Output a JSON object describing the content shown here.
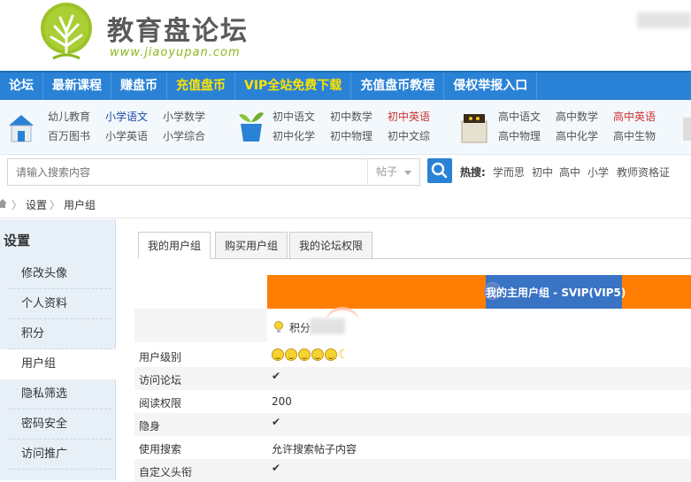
{
  "header": {
    "site_name": "教育盘论坛",
    "site_url": "www.jiaoyupan.com"
  },
  "nav": {
    "items": [
      {
        "label": "论坛",
        "gold": false
      },
      {
        "label": "最新课程",
        "gold": false
      },
      {
        "label": "赚盘币",
        "gold": false
      },
      {
        "label": "充值盘币",
        "gold": true
      },
      {
        "label": "VIP全站免费下载",
        "gold": true
      },
      {
        "label": "充值盘币教程",
        "gold": false
      },
      {
        "label": "侵权举报入口",
        "gold": false
      }
    ]
  },
  "categories": {
    "group1": [
      "幼儿教育",
      "小学语文",
      "小学数学",
      "百万图书",
      "小学英语",
      "小学综合"
    ],
    "group2": [
      "初中语文",
      "初中数学",
      "初中英语",
      "初中化学",
      "初中物理",
      "初中文综"
    ],
    "group3": [
      "高中语文",
      "高中数学",
      "高中英语",
      "高中物理",
      "高中化学",
      "高中生物"
    ]
  },
  "search": {
    "placeholder": "请输入搜索内容",
    "type": "帖子",
    "hot_label": "热搜:",
    "hot_items": [
      "学而思",
      "初中",
      "高中",
      "小学",
      "教师资格证"
    ]
  },
  "breadcrumb": {
    "items": [
      "设置",
      "用户组"
    ]
  },
  "sidebar": {
    "title": "设置",
    "items": [
      "修改头像",
      "个人资料",
      "积分",
      "用户组",
      "隐私筛选",
      "密码安全",
      "访问推广"
    ],
    "active_index": 3
  },
  "tabs": {
    "items": [
      "我的用户组",
      "购买用户组",
      "我的论坛权限"
    ],
    "active_index": 0
  },
  "group": {
    "title": "我的主用户组 - SVIP(VIP5)",
    "credit_label": "积分"
  },
  "permissions": {
    "rows": [
      {
        "label": "用户级别",
        "value": "",
        "kind": "stars"
      },
      {
        "label": "访问论坛",
        "value": "✔",
        "kind": "check"
      },
      {
        "label": "阅读权限",
        "value": "200",
        "kind": "text"
      },
      {
        "label": "隐身",
        "value": "✔",
        "kind": "check"
      },
      {
        "label": "使用搜索",
        "value": "允许搜索帖子内容",
        "kind": "text"
      },
      {
        "label": "自定义头衔",
        "value": "✔",
        "kind": "check"
      }
    ]
  },
  "colors": {
    "nav_blue": "#2a82d6",
    "accent_orange": "#ff7d00",
    "group_blue": "#3973c4",
    "check_green": "#5aa51c",
    "gold": "#ffe400"
  }
}
